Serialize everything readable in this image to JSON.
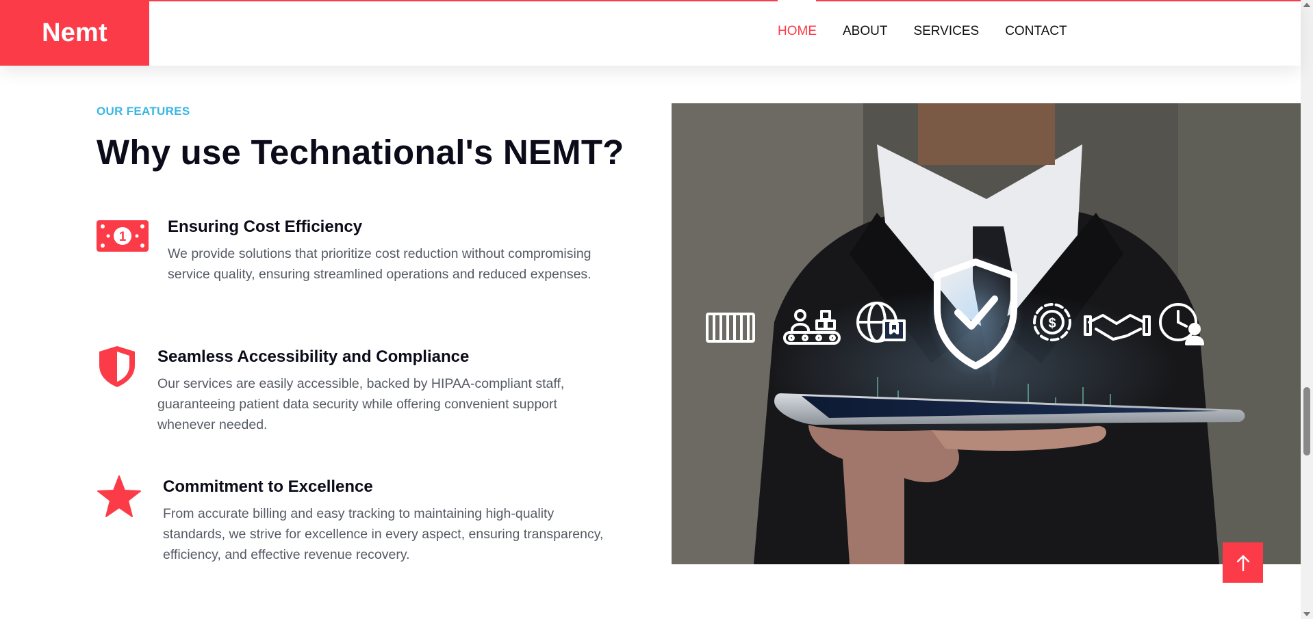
{
  "header": {
    "logo": "Nemt",
    "nav": [
      {
        "label": "HOME",
        "active": true
      },
      {
        "label": "ABOUT",
        "active": false
      },
      {
        "label": "SERVICES",
        "active": false
      },
      {
        "label": "CONTACT",
        "active": false
      }
    ]
  },
  "features_section": {
    "eyebrow": "OUR FEATURES",
    "title": "Why use Technational's NEMT?",
    "items": [
      {
        "icon": "money-bill-icon",
        "title": "Ensuring Cost Efficiency",
        "body": "We provide solutions that prioritize cost reduction without compromising service quality, ensuring streamlined operations and reduced expenses."
      },
      {
        "icon": "shield-icon",
        "title": "Seamless Accessibility and Compliance",
        "body": "Our services are easily accessible, backed by HIPAA-compliant staff, guaranteeing patient data security while offering convenient support whenever needed."
      },
      {
        "icon": "star-icon",
        "title": "Commitment to Excellence",
        "body": "From accurate billing and easy tracking to maintaining high-quality standards, we strive for excellence in every aspect, ensuring transparency, efficiency, and effective revenue recovery."
      }
    ]
  },
  "hero_image": {
    "icons": [
      "shipping-container-icon",
      "conveyor-worker-icon",
      "globe-package-icon",
      "shield-check-icon",
      "gear-money-icon",
      "handshake-icon",
      "clock-person-icon"
    ]
  },
  "back_to_top": {
    "icon": "arrow-up-icon"
  },
  "colors": {
    "accent": "#fb3c48",
    "eyebrow": "#38b6e3",
    "heading": "#0b0b1a",
    "body_text": "#555a63"
  }
}
